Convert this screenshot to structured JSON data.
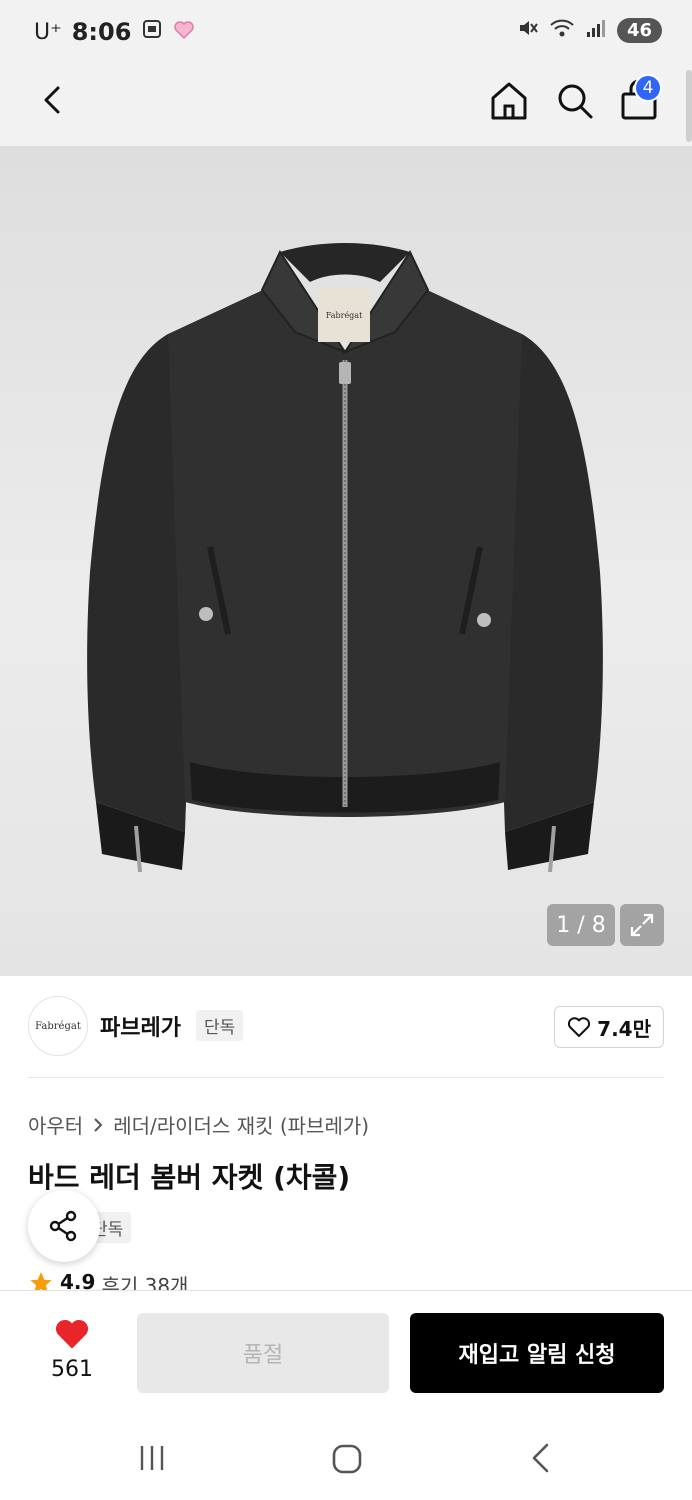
{
  "status_bar": {
    "carrier": "U⁺",
    "time": "8:06",
    "battery": "46"
  },
  "header": {
    "cart_count": "4"
  },
  "gallery": {
    "counter": "1 / 8",
    "label_text": "Fabrégat"
  },
  "brand": {
    "logo_text": "Fabrégat",
    "name": "파브레가",
    "tag": "단독",
    "likes": "7.4만"
  },
  "product": {
    "breadcrumb": [
      "아우터",
      "레더/라이더스 재킷 (파브레가)"
    ],
    "title": "바드 레더 봄버 자켓 (차콜)",
    "tag": "단독",
    "rating": "4.9",
    "reviews": "후기 38개"
  },
  "actions": {
    "wish_count": "561",
    "soldout_label": "품절",
    "restock_label": "재입고 알림 신청"
  },
  "colors": {
    "badge": "#2f66f6",
    "heart": "#e8262a",
    "star": "#f59e0b",
    "primary_button": "#000000"
  }
}
